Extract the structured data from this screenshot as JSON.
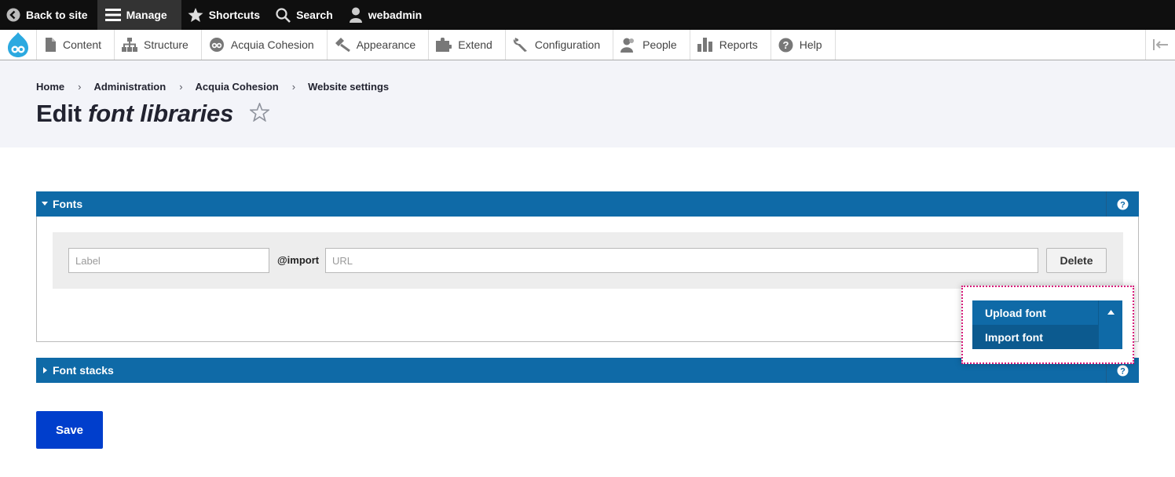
{
  "toolbar": {
    "back_label": "Back to site",
    "manage_label": "Manage",
    "shortcuts_label": "Shortcuts",
    "search_label": "Search",
    "user_label": "webadmin"
  },
  "tray": {
    "items": [
      {
        "label": "Content",
        "icon": "page-icon"
      },
      {
        "label": "Structure",
        "icon": "sitemap-icon"
      },
      {
        "label": "Acquia Cohesion",
        "icon": "cohesion-icon"
      },
      {
        "label": "Appearance",
        "icon": "paintbrush-icon"
      },
      {
        "label": "Extend",
        "icon": "puzzle-icon"
      },
      {
        "label": "Configuration",
        "icon": "wrench-icon"
      },
      {
        "label": "People",
        "icon": "people-icon"
      },
      {
        "label": "Reports",
        "icon": "bar-chart-icon"
      },
      {
        "label": "Help",
        "icon": "help-icon"
      }
    ]
  },
  "breadcrumb": [
    "Home",
    "Administration",
    "Acquia Cohesion",
    "Website settings"
  ],
  "breadcrumb_separator": "›",
  "page_title": {
    "prefix": "Edit",
    "emphasis": "font libraries"
  },
  "fonts_panel": {
    "title": "Fonts",
    "label_placeholder": "Label",
    "import_label": "@import",
    "url_placeholder": "URL",
    "delete_label": "Delete"
  },
  "dropdown": {
    "primary_label": "Upload font",
    "secondary_label": "Import font"
  },
  "font_stacks_panel": {
    "title": "Font stacks"
  },
  "save_label": "Save",
  "colors": {
    "toolbar_bg": "#0f0f0f",
    "accent_blue": "#0f6aa7",
    "save_blue": "#003ecc",
    "highlight_border": "#d81b7a"
  }
}
